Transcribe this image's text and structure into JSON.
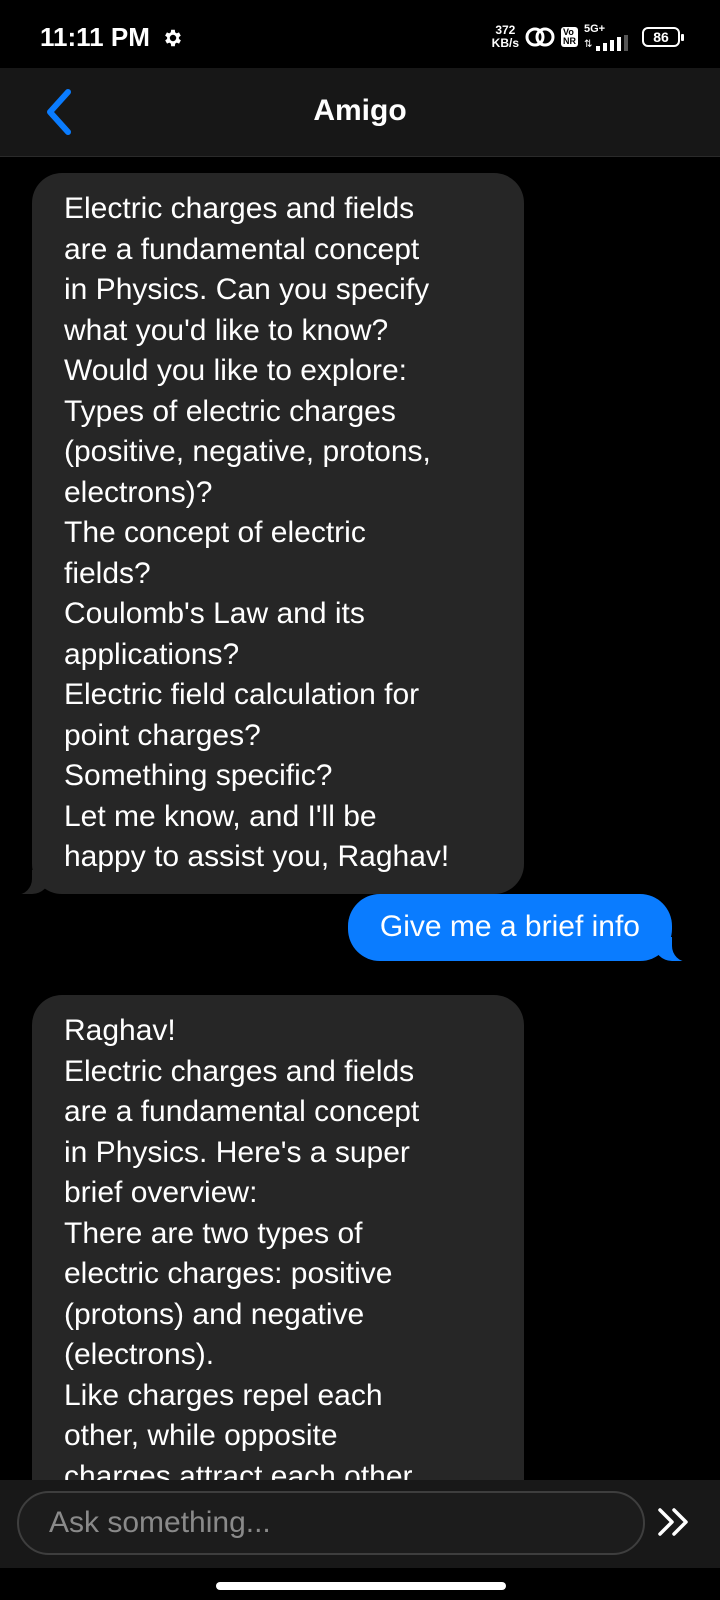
{
  "status_bar": {
    "time": "11:11 PM",
    "speed_value": "372",
    "speed_unit": "KB/s",
    "network": "5G+",
    "vonr_top": "Vo",
    "vonr_bottom": "NR",
    "battery": "86",
    "icons": [
      "gear-icon",
      "hotspot-icon",
      "vonr-icon",
      "signal-icon",
      "battery-icon"
    ]
  },
  "header": {
    "title": "Amigo",
    "back_icon": "chevron-left-icon",
    "accent_color": "#0a7cff"
  },
  "messages": [
    {
      "sender": "bot",
      "text": "Electric charges and fields\nare a fundamental concept\nin Physics. Can you specify\nwhat you'd like to know?\nWould you like to explore:\nTypes of electric charges\n(positive, negative, protons,\nelectrons)?\nThe concept of electric\nfields?\nCoulomb's Law and its\napplications?\nElectric field calculation for\npoint charges?\nSomething specific?\nLet me know, and I'll be\nhappy to assist you, Raghav!"
    },
    {
      "sender": "user",
      "text": "Give me a brief info"
    },
    {
      "sender": "bot",
      "text": "Raghav!\nElectric charges and fields\nare a fundamental concept\nin Physics. Here's a super\nbrief overview:\nThere are two types of\nelectric charges: positive\n(protons) and negative\n(electrons).\nLike charges repel each\nother, while opposite\ncharges attract each other."
    }
  ],
  "input": {
    "placeholder": "Ask something...",
    "value": "",
    "send_icon": "double-chevron-right-icon"
  }
}
